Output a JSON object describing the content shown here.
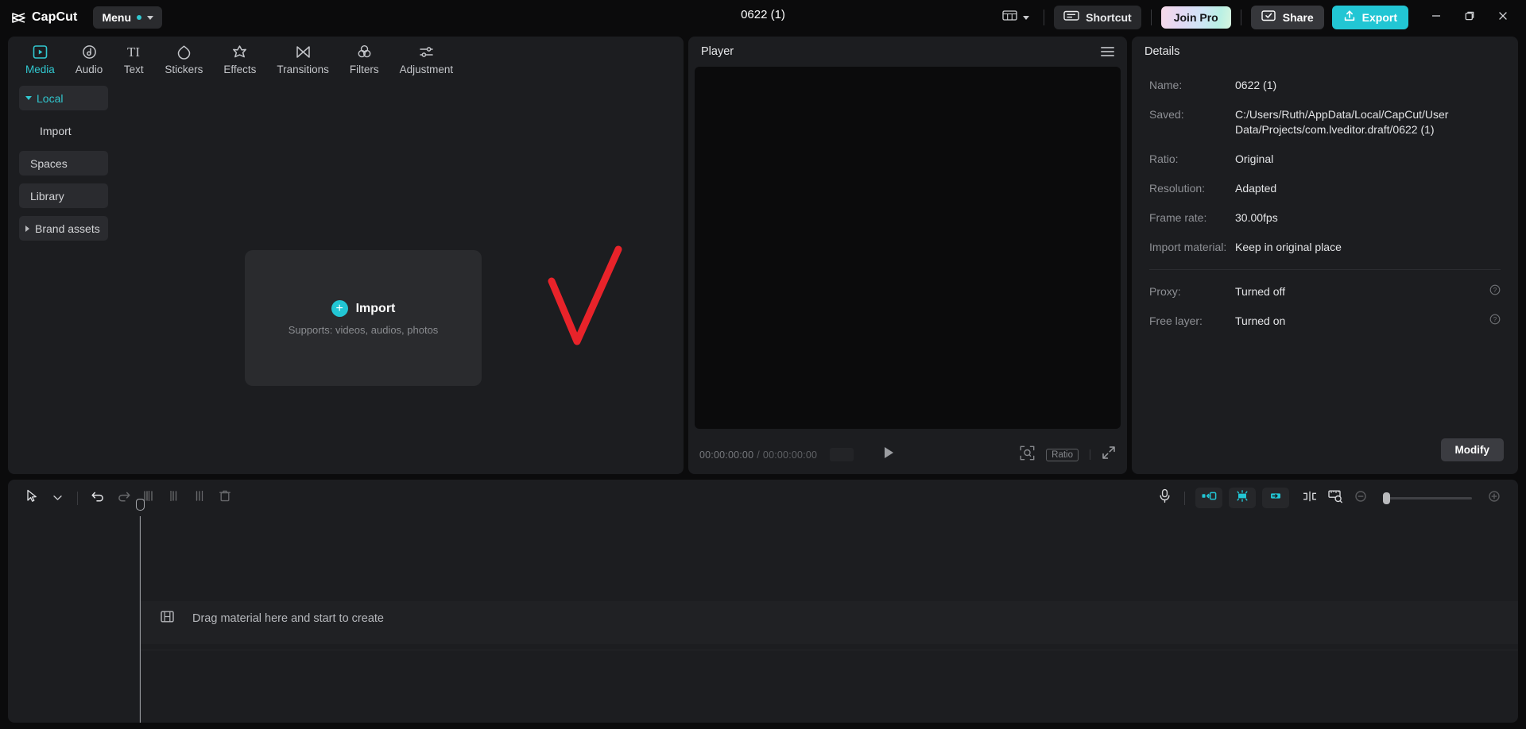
{
  "titlebar": {
    "brand": "CapCut",
    "brand_logo_icon": "capcut-logo-icon",
    "menu_label": "Menu",
    "project_title": "0622 (1)",
    "layout_icon": "layout-panels-icon",
    "layout_caret_icon": "chevron-down-icon",
    "shortcut_label": "Shortcut",
    "shortcut_icon": "keyboard-icon",
    "join_pro_label": "Join Pro",
    "share_label": "Share",
    "share_icon": "share-screen-icon",
    "export_label": "Export",
    "export_icon": "upload-icon",
    "minimize_icon": "minimize-icon",
    "maximize_icon": "maximize-restore-icon",
    "close_icon": "close-icon",
    "accent": "#22c6d4",
    "menu_dot_color": "#31c8d0"
  },
  "media": {
    "tabs": [
      {
        "label": "Media",
        "icon": "media-play-box-icon",
        "active": true
      },
      {
        "label": "Audio",
        "icon": "audio-note-icon",
        "active": false
      },
      {
        "label": "Text",
        "icon": "text-ti-icon",
        "active": false
      },
      {
        "label": "Stickers",
        "icon": "sticker-drop-icon",
        "active": false
      },
      {
        "label": "Effects",
        "icon": "effects-star-icon",
        "active": false
      },
      {
        "label": "Transitions",
        "icon": "transitions-bowtie-icon",
        "active": false
      },
      {
        "label": "Filters",
        "icon": "filters-circles-icon",
        "active": false
      },
      {
        "label": "Adjustment",
        "icon": "adjustment-sliders-icon",
        "active": false
      }
    ],
    "sidebar": [
      {
        "label": "Local",
        "state": "expanded-accent",
        "selected": true
      },
      {
        "label": "Import",
        "state": "child",
        "selected": false
      },
      {
        "label": "Spaces",
        "state": "normal",
        "selected": true
      },
      {
        "label": "Library",
        "state": "normal",
        "selected": true
      },
      {
        "label": "Brand assets",
        "state": "collapsed",
        "selected": true
      }
    ],
    "dropzone": {
      "title": "Import",
      "plus_icon": "plus-circle-icon",
      "subtitle": "Supports: videos, audios, photos"
    },
    "annotation": {
      "type": "red-check-mark",
      "color": "#e8232a"
    }
  },
  "player": {
    "title": "Player",
    "menu_icon": "hamburger-menu-icon",
    "current_time": "00:00:00:00",
    "time_separator": "/",
    "total_time": "00:00:00:00",
    "play_icon": "play-icon",
    "zoom_fit_icon": "zoom-fit-icon",
    "ratio_label": "Ratio",
    "fullscreen_icon": "fullscreen-icon"
  },
  "details": {
    "title": "Details",
    "rows": [
      {
        "key": "Name:",
        "value": "0622 (1)",
        "help": false
      },
      {
        "key": "Saved:",
        "value": "C:/Users/Ruth/AppData/Local/CapCut/User Data/Projects/com.lveditor.draft/0622 (1)",
        "help": false
      },
      {
        "key": "Ratio:",
        "value": "Original",
        "help": false
      },
      {
        "key": "Resolution:",
        "value": "Adapted",
        "help": false
      },
      {
        "key": "Frame rate:",
        "value": "30.00fps",
        "help": false
      },
      {
        "key": "Import material:",
        "value": "Keep in original place",
        "help": false
      }
    ],
    "rows_after_separator": [
      {
        "key": "Proxy:",
        "value": "Turned off",
        "help": true,
        "help_icon": "help-circle-icon"
      },
      {
        "key": "Free layer:",
        "value": "Turned on",
        "help": true,
        "help_icon": "help-circle-icon"
      }
    ],
    "modify_label": "Modify"
  },
  "timeline": {
    "tools_left": [
      {
        "name": "select-tool",
        "icon": "cursor-arrow-icon",
        "disabled": false
      },
      {
        "name": "select-dropdown",
        "icon": "chevron-down-icon",
        "disabled": false
      },
      {
        "name": "undo",
        "icon": "undo-icon",
        "disabled": false
      },
      {
        "name": "redo",
        "icon": "redo-icon",
        "disabled": true
      },
      {
        "name": "split",
        "icon": "split-clip-icon",
        "disabled": true
      },
      {
        "name": "trim-left",
        "icon": "trim-left-icon",
        "disabled": true
      },
      {
        "name": "trim-right",
        "icon": "trim-right-icon",
        "disabled": true
      },
      {
        "name": "delete",
        "icon": "trash-icon",
        "disabled": true
      }
    ],
    "tools_right": [
      {
        "name": "record-voiceover",
        "icon": "microphone-icon",
        "active": false
      },
      {
        "name": "keyframe-prev",
        "icon": "keyframe-left-icon",
        "active": true
      },
      {
        "name": "keyframe-add",
        "icon": "keyframe-add-icon",
        "active": true
      },
      {
        "name": "keyframe-next",
        "icon": "keyframe-right-icon",
        "active": true
      },
      {
        "name": "mirror-split",
        "icon": "mirror-split-icon",
        "active": false
      },
      {
        "name": "auto-caption",
        "icon": "ruler-search-icon",
        "active": false
      },
      {
        "name": "zoom-out",
        "icon": "zoom-out-icon",
        "active": false
      },
      {
        "name": "zoom-in",
        "icon": "zoom-in-icon",
        "active": false
      }
    ],
    "drop_hint": "Drag material here and start to create",
    "drop_hint_icon": "film-strip-icon",
    "playhead_position": "00:00:00:00"
  }
}
